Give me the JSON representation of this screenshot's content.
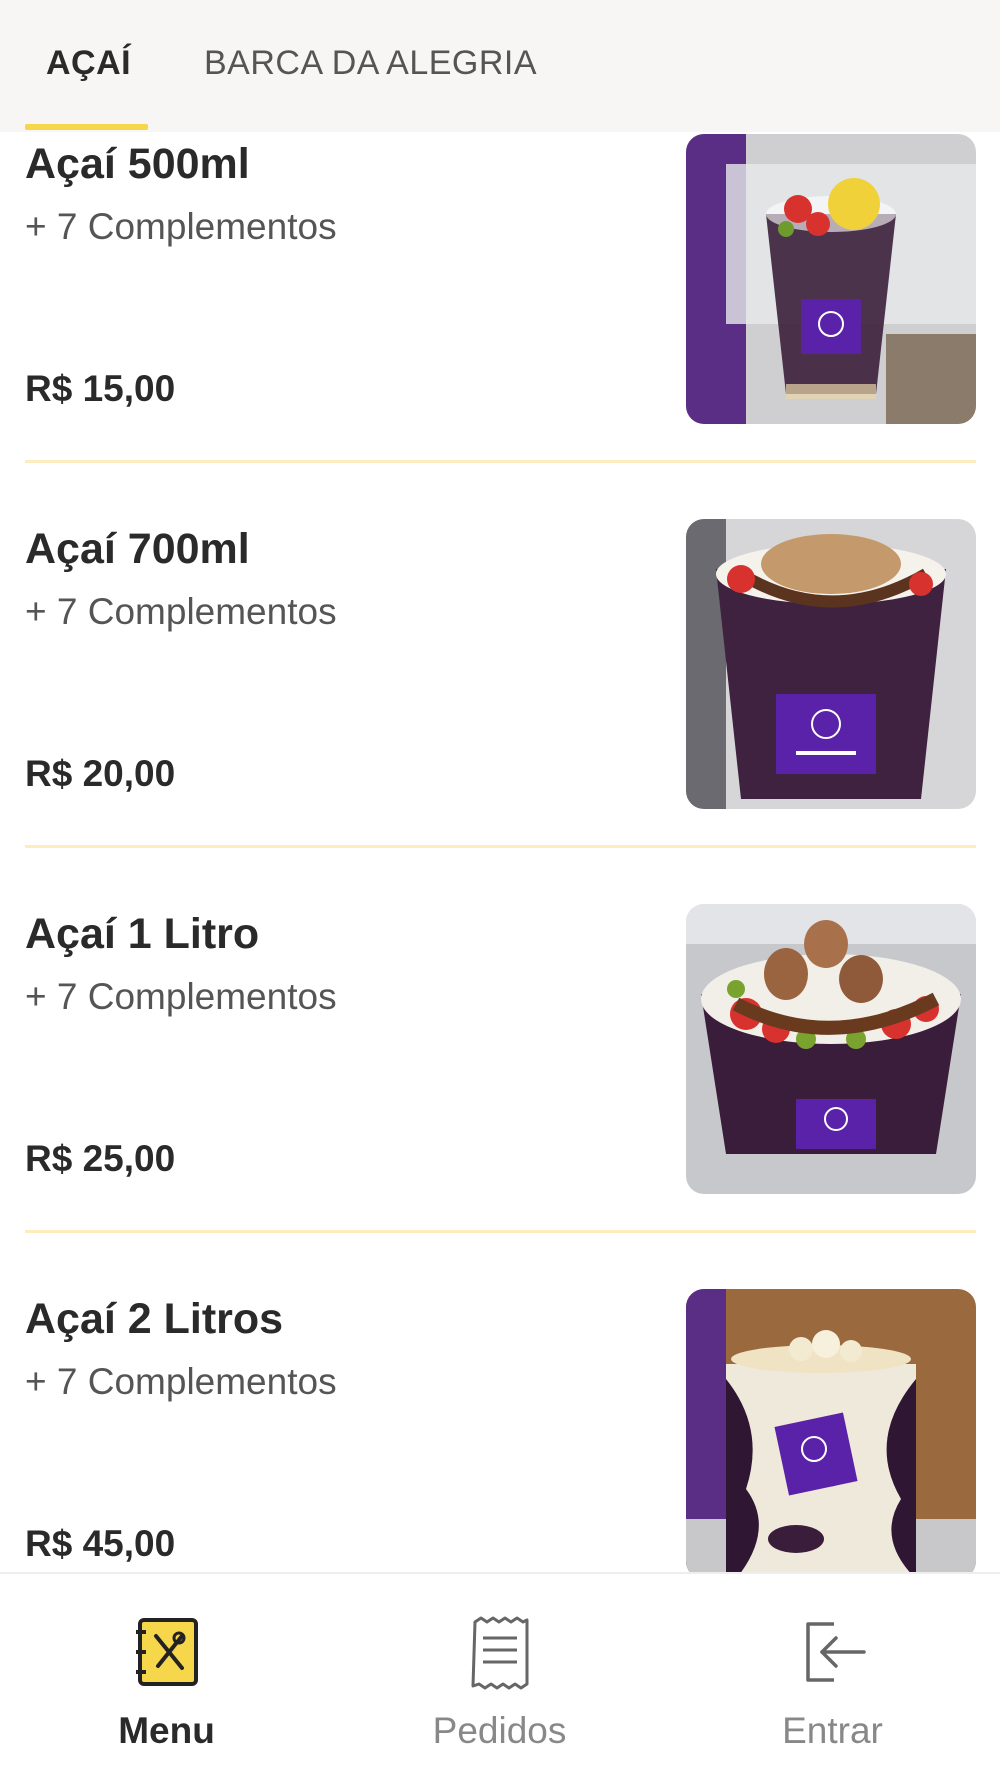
{
  "tabs": [
    {
      "label": "AÇAÍ",
      "active": true
    },
    {
      "label": "BARCA DA ALEGRIA",
      "active": false
    }
  ],
  "products": [
    {
      "name": "Açaí 500ml",
      "subtitle": "+ 7 Complementos",
      "price": "R$ 15,00",
      "image": "acai-cup-500ml"
    },
    {
      "name": "Açaí 700ml",
      "subtitle": "+ 7 Complementos",
      "price": "R$ 20,00",
      "image": "acai-cup-700ml"
    },
    {
      "name": "Açaí 1 Litro",
      "subtitle": "+ 7 Complementos",
      "price": "R$ 25,00",
      "image": "acai-bowl-1l"
    },
    {
      "name": "Açaí 2 Litros",
      "subtitle": "+ 7 Complementos",
      "price": "R$ 45,00",
      "image": "acai-tub-2l"
    }
  ],
  "bottom_nav": [
    {
      "label": "Menu",
      "icon": "menu-book-icon",
      "active": true
    },
    {
      "label": "Pedidos",
      "icon": "receipt-icon",
      "active": false
    },
    {
      "label": "Entrar",
      "icon": "login-icon",
      "active": false
    }
  ],
  "colors": {
    "accent": "#f6d64a",
    "divider": "#fbedbf",
    "tabbar_bg": "#f7f6f4",
    "acai_purple": "#4b1f73",
    "sticker_purple": "#5a22a8"
  }
}
